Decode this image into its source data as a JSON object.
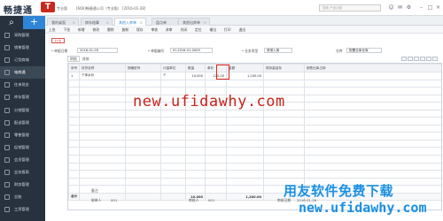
{
  "app": {
    "logo_text": "畅捷通",
    "logo_mark": "T",
    "edition": "专业版",
    "company": "[666]畅捷通公司（专业版） [2016-01-28]",
    "search_placeholder": "搜索 产品功能"
  },
  "sidebar": {
    "items": [
      {
        "label": "采购管理",
        "icon": "cart-icon"
      },
      {
        "label": "销售管理",
        "icon": "sales-icon"
      },
      {
        "label": "订货商城",
        "icon": "store-icon"
      },
      {
        "label": "电商通",
        "icon": "ecommerce-icon"
      },
      {
        "label": "往来现金",
        "icon": "cash-icon"
      },
      {
        "label": "库存管理",
        "icon": "warehouse-icon"
      },
      {
        "label": "分销管理",
        "icon": "distribution-icon"
      },
      {
        "label": "配送管理",
        "icon": "delivery-icon"
      },
      {
        "label": "零售管理",
        "icon": "retail-icon"
      },
      {
        "label": "促销管理",
        "icon": "promotion-icon"
      },
      {
        "label": "会员管理",
        "icon": "member-icon"
      },
      {
        "label": "业务报表",
        "icon": "report-icon"
      },
      {
        "label": "财务管理",
        "icon": "finance-icon"
      },
      {
        "label": "总账",
        "icon": "ledger-icon"
      },
      {
        "label": "工资管理",
        "icon": "salary-icon"
      }
    ]
  },
  "tabs": [
    {
      "label": "我的桌面",
      "active": false
    },
    {
      "label": "库存结算",
      "active": false
    },
    {
      "label": "其他入库单",
      "active": true
    },
    {
      "label": "盘点单",
      "active": false
    },
    {
      "label": "其他出库单",
      "active": false
    }
  ],
  "toolbar": {
    "items": [
      "上张",
      "下张",
      "新增",
      "修改",
      "删除",
      "复制",
      "保存",
      "审核",
      "弃审",
      "关闭",
      "定位",
      "输出",
      "打印",
      "退出"
    ]
  },
  "form": {
    "red_button": "红字",
    "date_label": "* 单据日期",
    "date_value": "2016-01-28",
    "code_label": "* 单据编号",
    "code_value": "IO-2016-01-0009",
    "type_label": "* 业务类型",
    "type_value": "其他入库",
    "wh_label": "仓库",
    "wh_value": "配置仓库仓库",
    "detail_tab": "明细",
    "detail_tab2": "其他"
  },
  "table": {
    "headers": [
      "序号",
      "存货名称",
      "规格型号",
      "计量单位",
      "数量",
      "单价",
      "金额",
      "现存量结存",
      "销售出库占用"
    ],
    "rows": [
      [
        "1",
        "个体水价",
        "",
        "个",
        "10.000",
        "120.00",
        "1,200.00",
        "",
        ""
      ]
    ],
    "empty_row_count": 15,
    "total_label": "合计",
    "total_qty": "10.000",
    "total_amount": "1,200.00"
  },
  "footer": {
    "note_label": "备注",
    "maker_label": "制单人",
    "maker_value": "001",
    "auditor_label": "审核人",
    "auditor_value": "001",
    "audit_date_label": "审核日期",
    "audit_date_value": "2016-01-28"
  },
  "watermarks": {
    "center": "new.ufidawhy.com",
    "corner_cn": "用友软件免费下载",
    "corner_url": "new.ufidawhy.com"
  }
}
